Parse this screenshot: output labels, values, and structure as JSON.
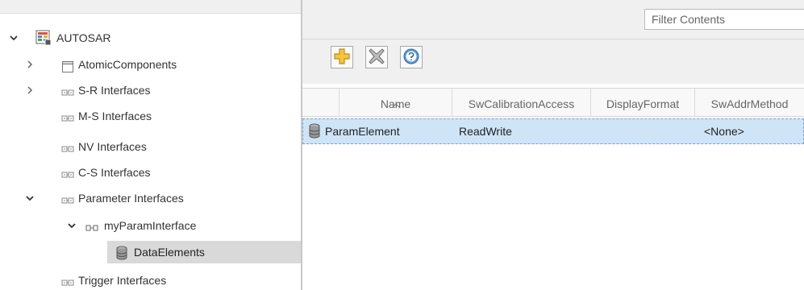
{
  "tree": {
    "root": {
      "label": "AUTOSAR",
      "expanded": true,
      "icon": "autosar-package-icon"
    },
    "items": [
      {
        "label": "AtomicComponents",
        "icon": "components-icon",
        "expandable": true,
        "expanded": false
      },
      {
        "label": "S-R Interfaces",
        "icon": "interfaces-icon",
        "expandable": true,
        "expanded": false
      },
      {
        "label": "M-S Interfaces",
        "icon": "interfaces-icon",
        "expandable": false
      },
      {
        "label": "NV Interfaces",
        "icon": "interfaces-icon",
        "expandable": false
      },
      {
        "label": "C-S Interfaces",
        "icon": "interfaces-icon",
        "expandable": false
      },
      {
        "label": "Parameter Interfaces",
        "icon": "interfaces-icon",
        "expandable": true,
        "expanded": true
      },
      {
        "label": "myParamInterface",
        "icon": "interface-icon",
        "expandable": true,
        "expanded": true
      },
      {
        "label": "DataElements",
        "icon": "database-icon",
        "selected": true
      },
      {
        "label": "Trigger Interfaces",
        "icon": "interfaces-icon",
        "expandable": false
      }
    ]
  },
  "filter": {
    "placeholder": "Filter Contents",
    "value": ""
  },
  "toolbar": {
    "add": {
      "icon": "add-icon"
    },
    "delete": {
      "icon": "delete-icon"
    },
    "help": {
      "icon": "help-icon"
    }
  },
  "table": {
    "columns": [
      "Name",
      "SwCalibrationAccess",
      "DisplayFormat",
      "SwAddrMethod"
    ],
    "sorted_column": "Name",
    "rows": [
      {
        "icon": "database-icon",
        "name": "ParamElement",
        "swCalibrationAccess": "ReadWrite",
        "displayFormat": "",
        "swAddrMethod": "<None>"
      }
    ]
  },
  "colors": {
    "selection": "#cfe4f7",
    "tree_selection": "#d9d9d9",
    "toolbar_bg": "#f0f0f0"
  }
}
